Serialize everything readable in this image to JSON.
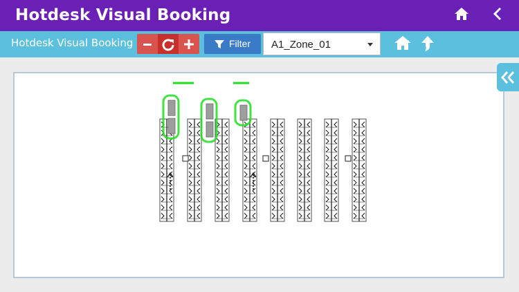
{
  "appbar": {
    "title": "Hotdesk Visual Booking",
    "home_icon": "home-icon",
    "back_icon": "chevron-left-icon",
    "background": "#6a1fb5"
  },
  "toolbar": {
    "subtitle": "Hotdesk Visual Booking",
    "zoom_out_icon": "minus-icon",
    "reset_icon": "refresh-icon",
    "zoom_in_icon": "plus-icon",
    "filter_label": "Filter",
    "zone_selected": "A1_Zone_01",
    "home_icon": "home-icon",
    "up_icon": "arrow-up-icon",
    "background": "#5bc0de"
  },
  "floorplan": {
    "desk_columns": 8,
    "available_desks": 5,
    "available_color": "#22dd22"
  },
  "side_panel": {
    "collapse_icon": "double-chevron-left-icon"
  }
}
